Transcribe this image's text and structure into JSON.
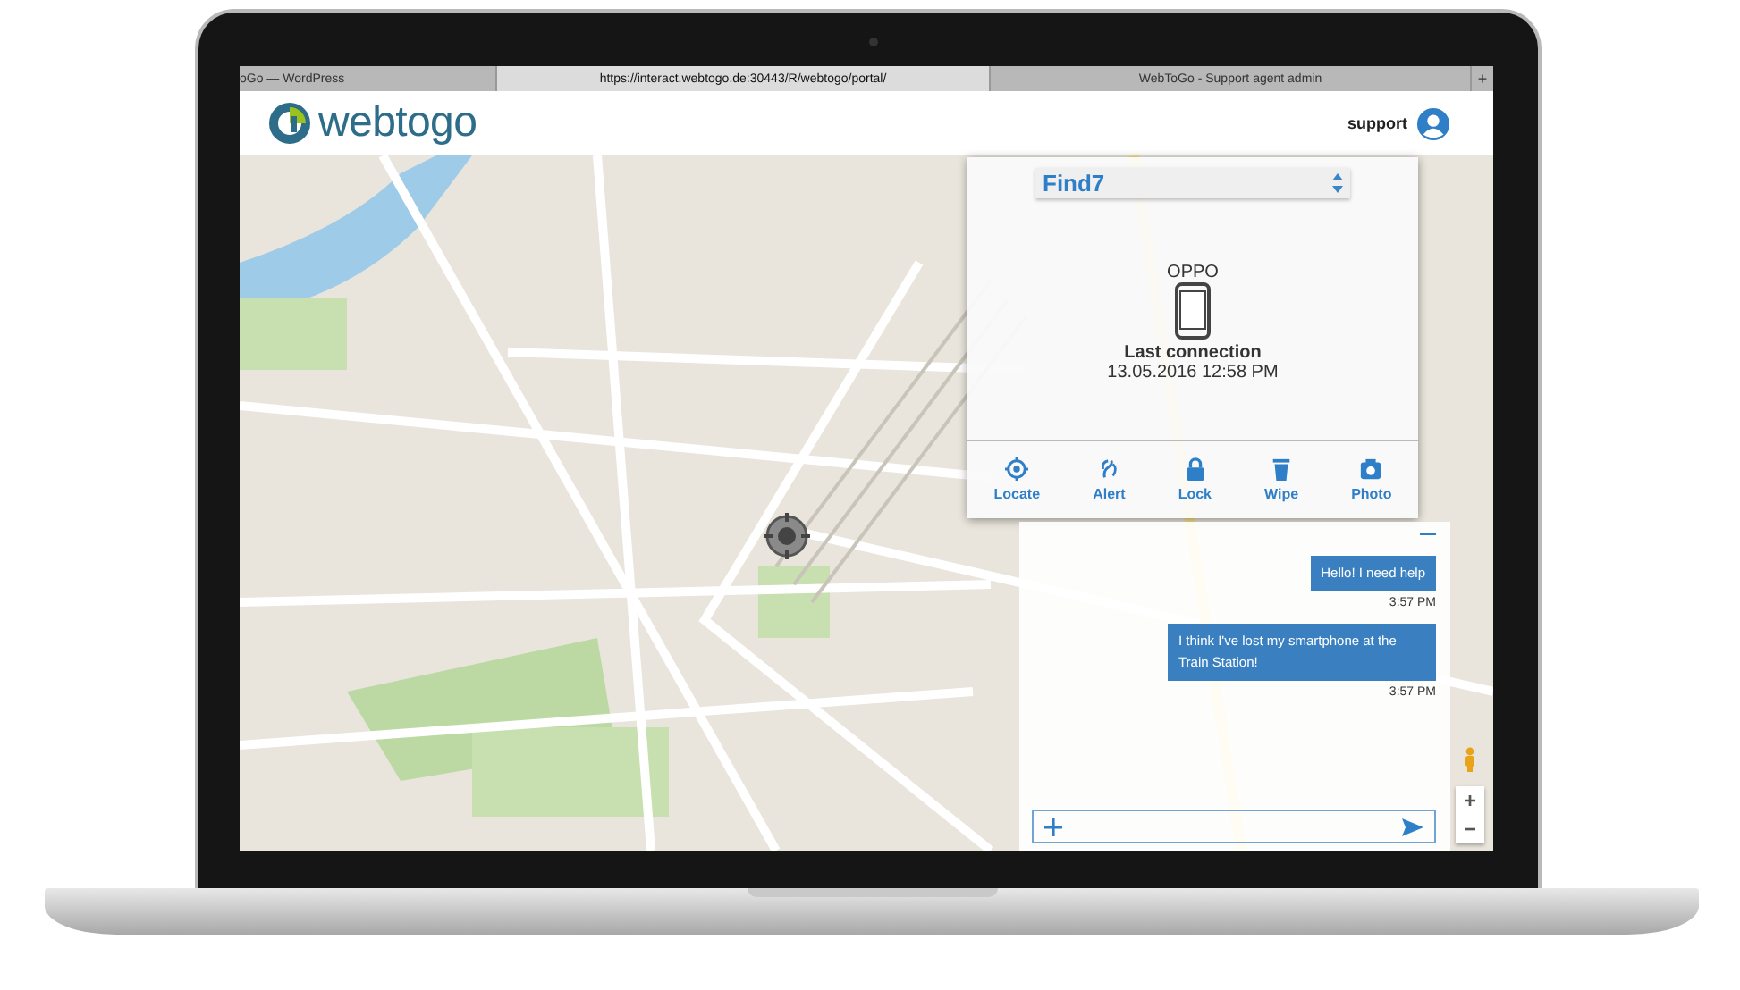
{
  "browser": {
    "tabs": [
      {
        "label": "oGo — WordPress",
        "selected": false
      },
      {
        "label": "https://interact.webtogo.de:30443/R/webtogo/portal/",
        "selected": true
      },
      {
        "label": "WebToGo - Support agent admin",
        "selected": false
      }
    ],
    "new_tab": "+"
  },
  "header": {
    "logo_text": "webtogo",
    "user": "support"
  },
  "device_panel": {
    "device_select": "Find7",
    "brand": "OPPO",
    "last_connection_label": "Last connection",
    "last_connection_time": "13.05.2016 12:58 PM",
    "actions": [
      {
        "kind": "locate",
        "label": "Locate"
      },
      {
        "kind": "alert",
        "label": "Alert"
      },
      {
        "kind": "lock",
        "label": "Lock"
      },
      {
        "kind": "wipe",
        "label": "Wipe"
      },
      {
        "kind": "photo",
        "label": "Photo"
      }
    ]
  },
  "chat": {
    "messages": [
      {
        "text": "Hello! I need help",
        "time": "3:57 PM"
      },
      {
        "text": "I think I've lost my smartphone at the Train Station!",
        "time": "3:57 PM"
      }
    ]
  },
  "map_controls": {
    "zoom_in": "+",
    "zoom_out": "−"
  }
}
